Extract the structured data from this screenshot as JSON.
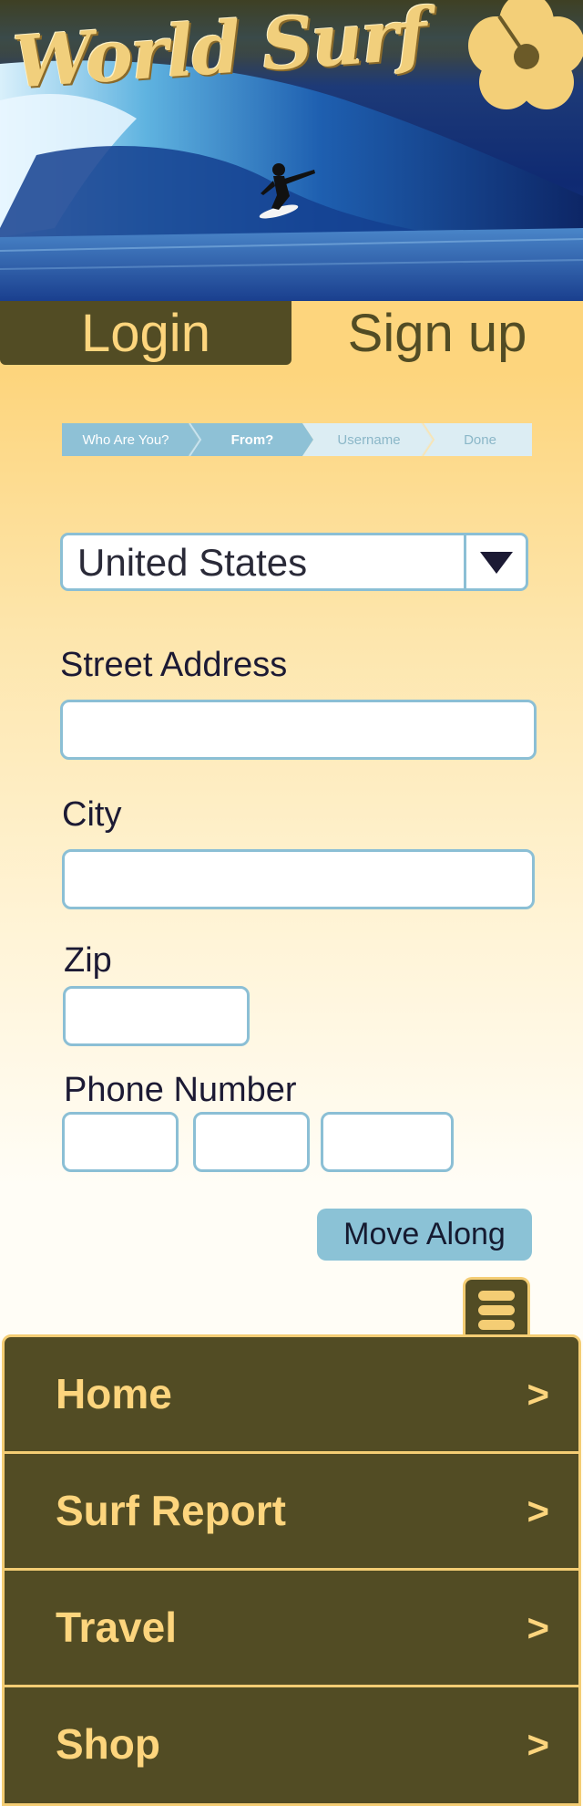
{
  "header": {
    "logo_text": "World Surf"
  },
  "tabs": {
    "login": "Login",
    "signup": "Sign up"
  },
  "steps": [
    {
      "label": "Who Are You?",
      "state": "completed"
    },
    {
      "label": "From?",
      "state": "active"
    },
    {
      "label": "Username",
      "state": "pending"
    },
    {
      "label": "Done",
      "state": "pending"
    }
  ],
  "form": {
    "country": {
      "value": "United States",
      "icon": "triangle-down-icon"
    },
    "street": {
      "label": "Street Address",
      "value": ""
    },
    "city": {
      "label": "City",
      "value": ""
    },
    "zip": {
      "label": "Zip",
      "value": ""
    },
    "phone": {
      "label": "Phone Number",
      "part1": "",
      "part2": "",
      "part3": ""
    },
    "submit": "Move Along"
  },
  "menu_toggle_icon": "hamburger-icon",
  "nav": [
    {
      "label": "Home",
      "arrow": ">"
    },
    {
      "label": "Surf Report",
      "arrow": ">"
    },
    {
      "label": "Travel",
      "arrow": ">"
    },
    {
      "label": "Shop",
      "arrow": ">"
    }
  ],
  "colors": {
    "olive": "#524c24",
    "gold": "#fdd57d",
    "accent_blue": "#8bbfd5",
    "step_active": "#8ec1d6",
    "step_pending": "#dcedf3"
  }
}
